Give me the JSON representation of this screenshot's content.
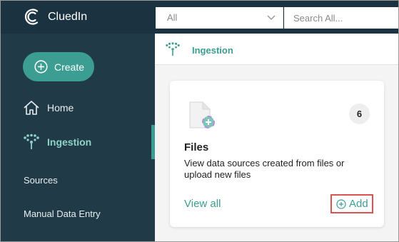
{
  "brand": {
    "name": "CluedIn",
    "logo_icon": "cluedin-logo-icon"
  },
  "sidebar": {
    "create_label": "Create",
    "items": [
      {
        "label": "Home",
        "icon": "home-icon"
      },
      {
        "label": "Ingestion",
        "icon": "ingestion-icon",
        "active": true
      }
    ],
    "sub_items": [
      {
        "label": "Sources"
      },
      {
        "label": "Manual Data Entry"
      }
    ]
  },
  "topbar": {
    "scope_value": "All",
    "search_placeholder": "Search All..."
  },
  "breadcrumb": {
    "label": "Ingestion",
    "icon": "ingestion-icon"
  },
  "card": {
    "title": "Files",
    "description": "View data sources created from files or upload new files",
    "count": "6",
    "view_all_label": "View all",
    "add_label": "Add",
    "icon": "file-add-icon"
  },
  "colors": {
    "sidebar_bg": "#203a47",
    "accent": "#3c9e92",
    "highlight_border": "#d9534f"
  }
}
